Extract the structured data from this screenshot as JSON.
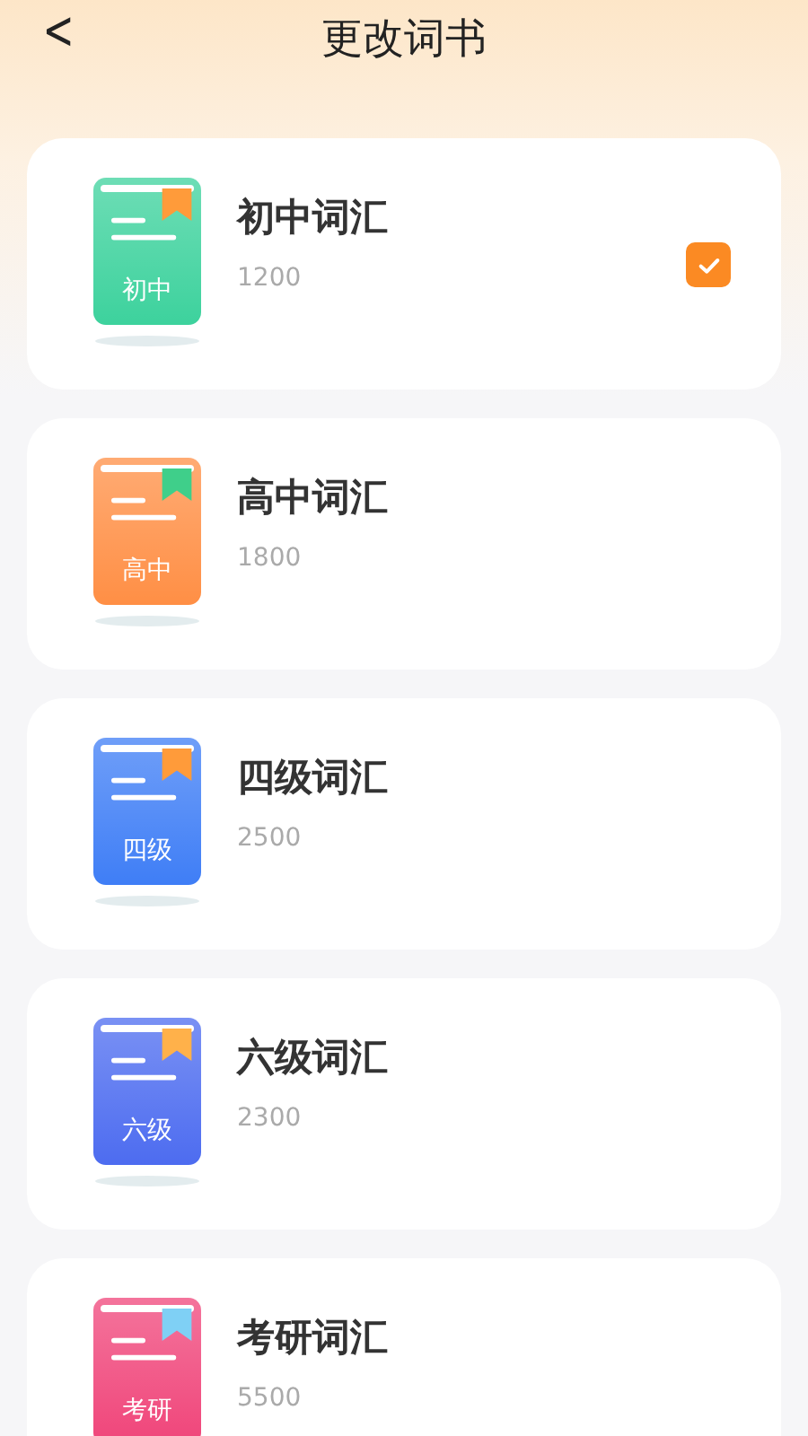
{
  "header": {
    "back": "<",
    "title": "更改词书"
  },
  "books": [
    {
      "name": "初中词汇",
      "count": "1200",
      "cover_label": "初中",
      "color": "#3dd29d",
      "ribbon": {
        "color": "#ff9b3a"
      },
      "selected": true
    },
    {
      "name": "高中词汇",
      "count": "1800",
      "cover_label": "高中",
      "color": "#ff8f45",
      "ribbon": {
        "color": "#3fcf8a"
      },
      "selected": false
    },
    {
      "name": "四级词汇",
      "count": "2500",
      "cover_label": "四级",
      "color": "#3f7ef6",
      "ribbon": {
        "color": "#ff9b3a"
      },
      "selected": false
    },
    {
      "name": "六级词汇",
      "count": "2300",
      "cover_label": "六级",
      "color": "#4d6cf0",
      "ribbon": {
        "color": "#ffb14a"
      },
      "selected": false
    },
    {
      "name": "考研词汇",
      "count": "5500",
      "cover_label": "考研",
      "color": "#f0457a",
      "ribbon": {
        "color": "#7fd0f5"
      },
      "selected": false
    }
  ]
}
